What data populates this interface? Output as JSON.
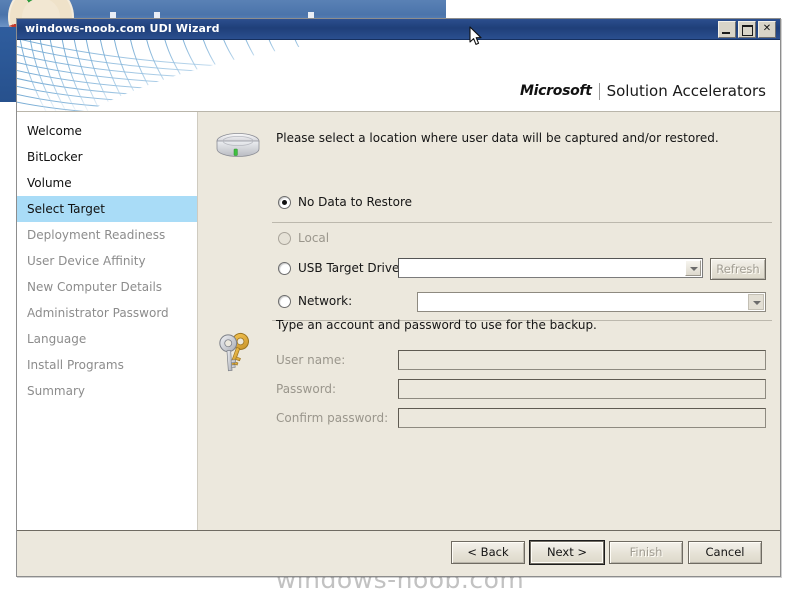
{
  "desktop": {
    "watermark": "windows-noob.com"
  },
  "window": {
    "title": "windows-noob.com UDI Wizard",
    "controls": {
      "minimize": "minimize-button",
      "maximize": "maximize-button",
      "close": "✕"
    },
    "brand": {
      "microsoft": "Microsoft",
      "product": "Solution Accelerators"
    }
  },
  "sidebar": {
    "items": [
      {
        "label": "Welcome",
        "state": "enabled"
      },
      {
        "label": "BitLocker",
        "state": "enabled"
      },
      {
        "label": "Volume",
        "state": "enabled"
      },
      {
        "label": "Select Target",
        "state": "selected"
      },
      {
        "label": "Deployment Readiness",
        "state": "disabled"
      },
      {
        "label": "User Device Affinity",
        "state": "disabled"
      },
      {
        "label": "New Computer Details",
        "state": "disabled"
      },
      {
        "label": "Administrator Password",
        "state": "disabled"
      },
      {
        "label": "Language",
        "state": "disabled"
      },
      {
        "label": "Install Programs",
        "state": "disabled"
      },
      {
        "label": "Summary",
        "state": "disabled"
      }
    ]
  },
  "main": {
    "intro": "Please select a location where user data will be captured and/or restored.",
    "options": {
      "no_data": {
        "label": "No Data to Restore",
        "checked": true,
        "enabled": true
      },
      "local": {
        "label": "Local",
        "checked": false,
        "enabled": false
      },
      "usb": {
        "label": "USB Target Drive:",
        "checked": false,
        "enabled": true,
        "value": ""
      },
      "network": {
        "label": "Network:",
        "checked": false,
        "enabled": true,
        "value": ""
      }
    },
    "refresh_button": {
      "label": "Refresh",
      "enabled": false
    },
    "credentials": {
      "title": "Type an account and password to use for the backup.",
      "fields": [
        {
          "label": "User name:",
          "value": ""
        },
        {
          "label": "Password:",
          "value": ""
        },
        {
          "label": "Confirm password:",
          "value": ""
        }
      ]
    }
  },
  "footer": {
    "buttons": [
      {
        "label": "< Back",
        "state": "enabled"
      },
      {
        "label": "Next >",
        "state": "default"
      },
      {
        "label": "Finish",
        "state": "disabled"
      },
      {
        "label": "Cancel",
        "state": "enabled"
      }
    ]
  },
  "colors": {
    "titlebar": "#1f3f79",
    "selection": "#a9dcf7",
    "content_bg": "#ece8dd",
    "sidebar_bg": "#ffffff",
    "disabled_text": "#9a968c"
  }
}
